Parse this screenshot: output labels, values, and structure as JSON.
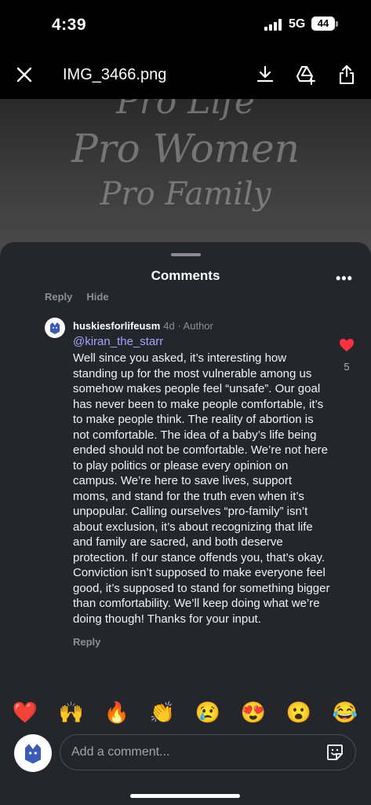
{
  "status": {
    "time": "4:39",
    "network": "5G",
    "battery": "44"
  },
  "viewer": {
    "filename": "IMG_3466.png"
  },
  "photo": {
    "lines": [
      "Pro Life",
      "Pro Women",
      "Pro Family"
    ]
  },
  "sheet": {
    "title": "Comments",
    "prev_reply": "Reply",
    "prev_hide": "Hide"
  },
  "comment": {
    "username": "huskiesforlifeusm",
    "meta": "4d · Author",
    "mention": "@kiran_the_starr",
    "body": "Well since you asked, it’s interesting how standing up for the most vulnerable among us somehow makes people feel “unsafe”. Our goal has never been to make people comfortable, it’s to make people think. The reality of abortion is not comfortable. The idea of a baby’s life being ended should not be comfortable. We’re not here to play politics or please every opinion on campus. We’re here to save lives, support moms, and stand for the truth even when it’s unpopular. Calling ourselves “pro-family” isn’t about exclusion, it’s about recognizing that life and family are sacred, and both deserve protection. If our stance offends you, that’s okay. Conviction isn’t supposed to make everyone feel good, it’s supposed to stand for something bigger than comfortability.  We’ll keep doing what we’re doing though! Thanks for your input.",
    "like_count": "5",
    "reply_label": "Reply"
  },
  "reactions": [
    "❤️",
    "🙌",
    "🔥",
    "👏",
    "😢",
    "😍",
    "😮",
    "😂"
  ],
  "composer": {
    "placeholder": "Add a comment..."
  },
  "colors": {
    "sheet_bg": "#25262b",
    "mention": "#a0a4ff",
    "like": "#ff3040"
  }
}
